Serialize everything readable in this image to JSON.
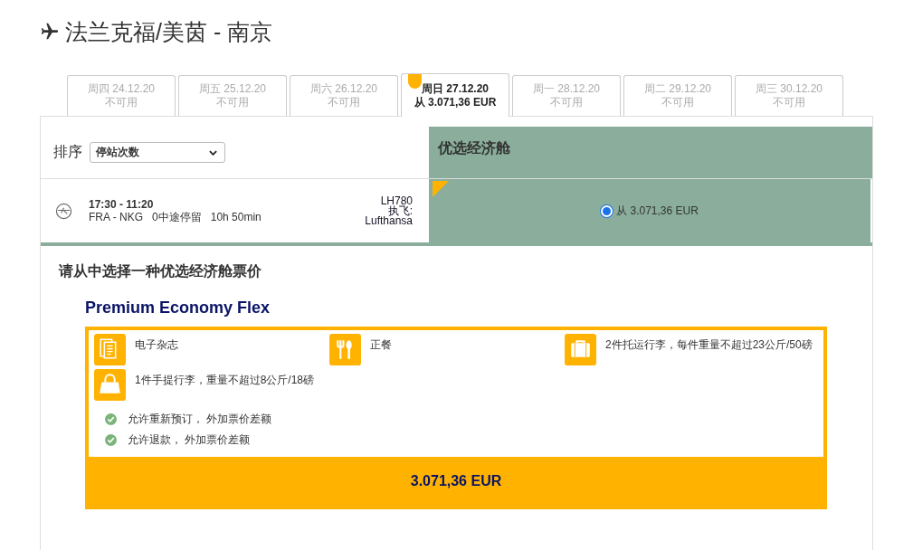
{
  "page_title": "法兰克福/美茵 - 南京",
  "tabs": [
    {
      "date": "周四 24.12.20",
      "status": "不可用",
      "selected": false
    },
    {
      "date": "周五 25.12.20",
      "status": "不可用",
      "selected": false
    },
    {
      "date": "周六 26.12.20",
      "status": "不可用",
      "selected": false
    },
    {
      "date": "周日 27.12.20",
      "status": "从 3.071,36 EUR",
      "selected": true
    },
    {
      "date": "周一 28.12.20",
      "status": "不可用",
      "selected": false
    },
    {
      "date": "周二 29.12.20",
      "status": "不可用",
      "selected": false
    },
    {
      "date": "周三 30.12.20",
      "status": "不可用",
      "selected": false
    }
  ],
  "sort": {
    "label": "排序",
    "value": "停站次数"
  },
  "fare_column": {
    "title": "优选经济舱"
  },
  "flight": {
    "times": "17:30 - 11:20",
    "route": "FRA - NKG",
    "stops": "0中途停留",
    "duration": "10h 50min",
    "flight_number": "LH780",
    "operated_label": "执飞:",
    "airline": "Lufthansa",
    "fare": {
      "price": "从 3.071,36 EUR",
      "selected": true
    }
  },
  "details": {
    "heading": "请从中选择一种优选经济舱票价",
    "fare_name": "Premium Economy Flex",
    "features": [
      {
        "kind": "magazine",
        "text": "电子杂志"
      },
      {
        "kind": "meal",
        "text": "正餐"
      },
      {
        "kind": "baggage",
        "text": "2件托运行李，每件重量不超过23公斤/50磅"
      },
      {
        "kind": "handbag",
        "text": "1件手提行李，重量不超过8公斤/18磅"
      }
    ],
    "conditions": [
      "允许重新预订， 外加票价差额",
      "允许退款， 外加票价差额"
    ],
    "price": "3.071,36 EUR"
  }
}
